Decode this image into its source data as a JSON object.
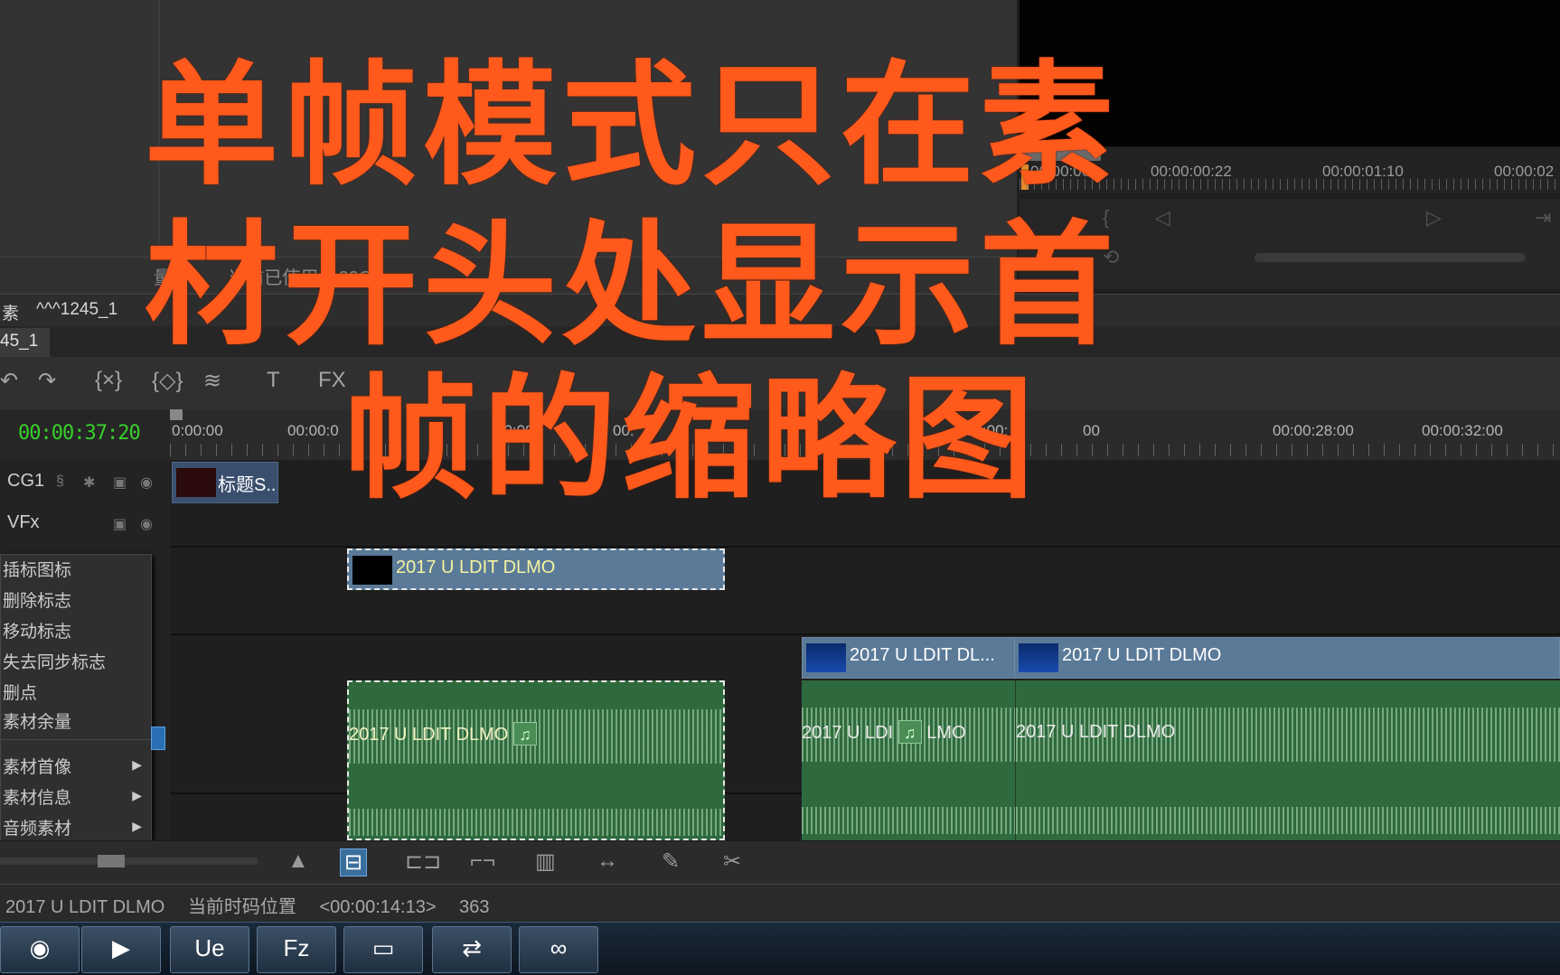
{
  "overlay_caption": {
    "line1": "单帧模式只在素",
    "line2": "材开头处显示首",
    "line3": "帧的缩略图",
    "color": "#ff5a1c"
  },
  "source_panel": {
    "status_items": [
      "量 0",
      "当前已使用 0.20GB"
    ]
  },
  "player": {
    "timecodes": [
      "00:00:00",
      "00:00:00:22",
      "00:00:01:10",
      "00:00:02"
    ],
    "playhead_color": "#e48a2c"
  },
  "sequence": {
    "bin_label": "素",
    "name": "^^^1245_1",
    "tab": "45_1"
  },
  "toolbar": {
    "buttons": [
      {
        "icon": "undo-icon",
        "glyph": "↶"
      },
      {
        "icon": "redo-icon",
        "glyph": "↷"
      },
      {
        "icon": "mark-in-out-icon",
        "glyph": "{×}"
      },
      {
        "icon": "mark-clip-icon",
        "glyph": "{◇}"
      },
      {
        "icon": "audio-wave-icon",
        "glyph": "≋"
      },
      {
        "icon": "title-icon",
        "glyph": "T"
      },
      {
        "icon": "fx-icon",
        "glyph": "FX"
      }
    ]
  },
  "timeline": {
    "current_timecode": "00:00:37:20",
    "timecode_color": "#36d12a",
    "ruler_labels": [
      "0:00:00",
      "00:00:0",
      "00:00:",
      "00:",
      "00:00:",
      "00",
      "00:00:28:00",
      "00:00:32:00"
    ],
    "tracks": [
      {
        "name": "CG1"
      },
      {
        "name": "VFx"
      }
    ],
    "clips": {
      "title_clip": "标题S...",
      "video_clip_1": "2017 U LDIT DLMO",
      "video_clip_2": "2017 U LDIT DL...",
      "video_clip_3": "2017 U LDIT DLMO",
      "audio_clip_1": "2017 U LDIT DLMO",
      "audio_clip_2": "2017 U LDI",
      "audio_clip_2_tail": "LMO",
      "audio_clip_3": "2017 U LDIT DLMO"
    }
  },
  "context_menu": {
    "items": [
      {
        "label": "插标图标",
        "submenu": false
      },
      {
        "label": "删除标志",
        "submenu": false
      },
      {
        "label": "移动标志",
        "submenu": false
      },
      {
        "label": "失去同步标志",
        "submenu": false
      },
      {
        "label": "删点",
        "submenu": false
      },
      {
        "label": "素材余量",
        "submenu": false
      },
      {
        "label": "素材首像",
        "submenu": true
      },
      {
        "label": "素材信息",
        "submenu": true
      },
      {
        "label": "音频素材",
        "submenu": true
      }
    ]
  },
  "edit_tools": [
    {
      "icon": "triangle-up-icon",
      "glyph": "▲"
    },
    {
      "icon": "ripple-edit-icon",
      "glyph": "⊟",
      "active": true
    },
    {
      "icon": "trim-icon",
      "glyph": "⊏⊐"
    },
    {
      "icon": "slip-icon",
      "glyph": "⌐¬"
    },
    {
      "icon": "bars-icon",
      "glyph": "▥"
    },
    {
      "icon": "stretch-icon",
      "glyph": "↔"
    },
    {
      "icon": "pen-icon",
      "glyph": "✎"
    },
    {
      "icon": "razor-icon",
      "glyph": "✂"
    }
  ],
  "status_bar": {
    "clip_name": "2017 U LDIT DLMO",
    "position_label": "当前时码位置",
    "position_value": "<00:00:14:13>",
    "frames": "363"
  },
  "taskbar": {
    "apps": [
      {
        "name": "firefox-icon",
        "glyph": "◉"
      },
      {
        "name": "media-player-icon",
        "glyph": "▶"
      },
      {
        "name": "ultraedit-icon",
        "glyph": "Ue"
      },
      {
        "name": "filezilla-icon",
        "glyph": "Fz"
      },
      {
        "name": "folder-icon",
        "glyph": "▭"
      },
      {
        "name": "teamviewer-icon",
        "glyph": "⇄"
      },
      {
        "name": "baidu-netdisk-icon",
        "glyph": "∞"
      }
    ]
  }
}
